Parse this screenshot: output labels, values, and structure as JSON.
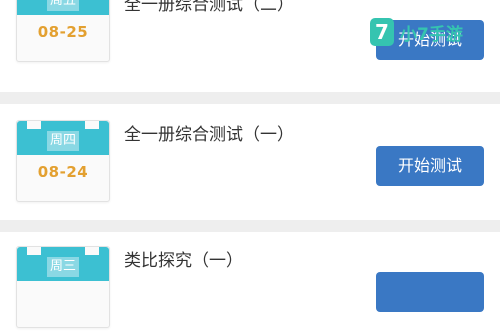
{
  "colors": {
    "calendar_header": "#3cc0d2",
    "date_text": "#e3a030",
    "button_bg": "#3a78c4",
    "divider": "#eeeeee",
    "watermark": "#35c4b0"
  },
  "items": [
    {
      "weekday": "周五",
      "date": "08-25",
      "title": "全一册综合测试（二）",
      "button_label": "开始测试"
    },
    {
      "weekday": "周四",
      "date": "08-24",
      "title": "全一册综合测试（一）",
      "button_label": "开始测试"
    },
    {
      "weekday": "周三",
      "date": "",
      "title": "类比探究（一）",
      "button_label": ""
    }
  ],
  "watermark": {
    "badge": "7",
    "text": "小7手游"
  }
}
